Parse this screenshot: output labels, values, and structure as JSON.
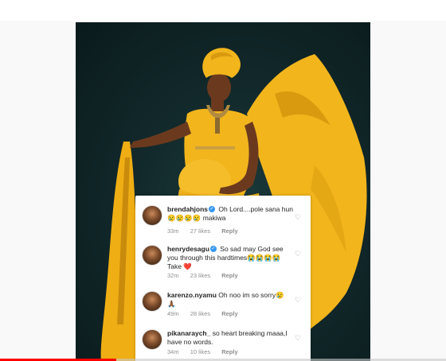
{
  "video": {
    "progress": 0.26,
    "progress_color": "#ff0000"
  },
  "comments": [
    {
      "username": "brendahjons",
      "verified": true,
      "text": "Oh Lord....pole sana hun 😢😢😢😢 makiwa",
      "time": "33m",
      "likes": "27 likes",
      "reply": "Reply"
    },
    {
      "username": "henrydesagu",
      "verified": true,
      "text": "So sad may God see you through this hardtimes😭😭😭😭 Take ❤️",
      "time": "32m",
      "likes": "23 likes",
      "reply": "Reply"
    },
    {
      "username": "karenzo.nyamu",
      "verified": false,
      "text": "Oh noo im so sorry😢 🙏🏾",
      "time": "49m",
      "likes": "28 likes",
      "reply": "Reply"
    },
    {
      "username": "pikanaraych_",
      "verified": false,
      "text": "so heart breaking maaa,I have no words.",
      "time": "34m",
      "likes": "10 likes",
      "reply": "Reply"
    }
  ],
  "icons": {
    "verified": "verified-badge-icon",
    "heart": "heart-icon"
  },
  "colors": {
    "photo_background": "#12292b",
    "dress": "#f2b51c",
    "verified": "#3897f0"
  }
}
